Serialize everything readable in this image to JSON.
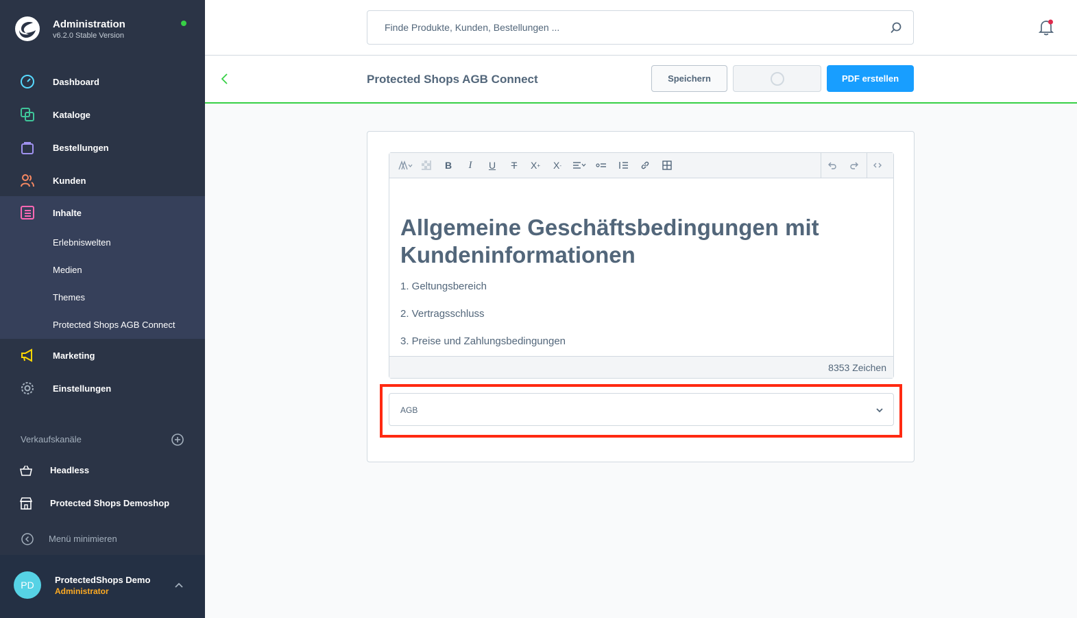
{
  "brand": {
    "title": "Administration",
    "version": "v6.2.0 Stable Version"
  },
  "nav": {
    "dashboard": "Dashboard",
    "kataloge": "Kataloge",
    "bestellungen": "Bestellungen",
    "kunden": "Kunden",
    "inhalte": "Inhalte",
    "inhalte_sub": [
      "Erlebniswelten",
      "Medien",
      "Themes",
      "Protected Shops AGB Connect"
    ],
    "marketing": "Marketing",
    "einstellungen": "Einstellungen"
  },
  "sales_channels": {
    "label": "Verkaufskanäle",
    "items": [
      "Headless",
      "Protected Shops Demoshop"
    ]
  },
  "minimize_label": "Menü minimieren",
  "user": {
    "initials": "PD",
    "name": "ProtectedShops Demo",
    "role": "Administrator"
  },
  "search": {
    "placeholder": "Finde Produkte, Kunden, Bestellungen ..."
  },
  "smartbar": {
    "title": "Protected Shops AGB Connect",
    "save_label": "Speichern",
    "pdf_label": "PDF erstellen"
  },
  "editor": {
    "heading": "Allgemeine Geschäftsbedingungen mit Kundeninformationen",
    "paragraphs": [
      "1. Geltungsbereich",
      "2. Vertragsschluss",
      "3. Preise und Zahlungsbedingungen"
    ],
    "char_count": "8353 Zeichen"
  },
  "document_select": {
    "value": "AGB"
  },
  "colors": {
    "sidebar": "#2b3446",
    "accent_green": "#37d046",
    "primary_blue": "#189eff",
    "highlight_red": "#ff2a12",
    "role_orange": "#ffab22"
  }
}
